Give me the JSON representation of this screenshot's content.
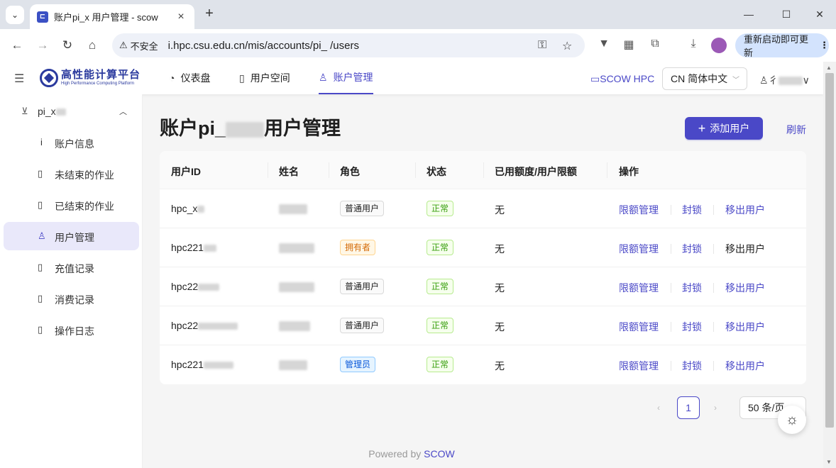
{
  "browser": {
    "tab_title": "账户pi_x   用户管理 - scow",
    "url": "i.hpc.csu.edu.cn/mis/accounts/pi_      /users",
    "insecure_label": "不安全",
    "update_label": "重新启动即可更新"
  },
  "header": {
    "logo_main": "高性能计算平台",
    "logo_sub": "High Performance Computing Platform",
    "nav": [
      {
        "label": "仪表盘",
        "icon": "dashboard-icon"
      },
      {
        "label": "用户空间",
        "icon": "book-icon"
      },
      {
        "label": "账户管理",
        "icon": "user-icon",
        "active": true
      }
    ],
    "scow_link": "SCOW HPC",
    "language": "CN 简体中文",
    "user_name": "彳"
  },
  "sidebar": {
    "group_label": "pi_x",
    "items": [
      {
        "label": "账户信息",
        "icon": "info-icon"
      },
      {
        "label": "未结束的作业",
        "icon": "book-icon"
      },
      {
        "label": "已结束的作业",
        "icon": "book-icon"
      },
      {
        "label": "用户管理",
        "icon": "user-icon",
        "active": true
      },
      {
        "label": "充值记录",
        "icon": "book-icon"
      },
      {
        "label": "消费记录",
        "icon": "book-icon"
      },
      {
        "label": "操作日志",
        "icon": "book-icon"
      }
    ]
  },
  "main": {
    "title_prefix": "账户pi_",
    "title_suffix": "用户管理",
    "add_user_label": "添加用户",
    "refresh_label": "刷新",
    "columns": [
      "用户ID",
      "姓名",
      "角色",
      "状态",
      "已用额度/用户限额",
      "操作"
    ],
    "rows": [
      {
        "user_id": "hpc_x",
        "role": "普通用户",
        "role_type": "default",
        "status": "正常",
        "quota": "无",
        "actions": [
          "限额管理",
          "封锁",
          "移出用户"
        ],
        "remove_enabled": true
      },
      {
        "user_id": "hpc221",
        "role": "拥有者",
        "role_type": "owner",
        "status": "正常",
        "quota": "无",
        "actions": [
          "限额管理",
          "封锁",
          "移出用户"
        ],
        "remove_enabled": false
      },
      {
        "user_id": "hpc22",
        "role": "普通用户",
        "role_type": "default",
        "status": "正常",
        "quota": "无",
        "actions": [
          "限额管理",
          "封锁",
          "移出用户"
        ],
        "remove_enabled": true
      },
      {
        "user_id": "hpc22",
        "role": "普通用户",
        "role_type": "default",
        "status": "正常",
        "quota": "无",
        "actions": [
          "限额管理",
          "封锁",
          "移出用户"
        ],
        "remove_enabled": true
      },
      {
        "user_id": "hpc221",
        "role": "管理员",
        "role_type": "admin",
        "status": "正常",
        "quota": "无",
        "actions": [
          "限额管理",
          "封锁",
          "移出用户"
        ],
        "remove_enabled": true
      }
    ]
  },
  "pagination": {
    "current_page": "1",
    "page_size": "50 条/页"
  },
  "footer": {
    "prefix": "Powered by ",
    "brand": "SCOW"
  },
  "colors": {
    "accent": "#4a48c7",
    "status_green": "#389e0d",
    "owner_orange": "#d46b08",
    "admin_blue": "#0958d9"
  }
}
